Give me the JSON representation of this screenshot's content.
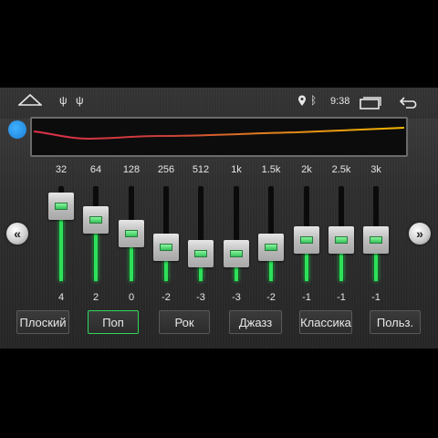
{
  "status_bar": {
    "time": "9:38",
    "icons": [
      "home-icon",
      "usb-icon",
      "usb-icon",
      "location-icon",
      "bluetooth-icon",
      "recents-icon",
      "back-icon"
    ]
  },
  "equalizer": {
    "bands": [
      {
        "freq": "32",
        "value": "4",
        "level": 4
      },
      {
        "freq": "64",
        "value": "2",
        "level": 2
      },
      {
        "freq": "128",
        "value": "0",
        "level": 0
      },
      {
        "freq": "256",
        "value": "-2",
        "level": -2
      },
      {
        "freq": "512",
        "value": "-3",
        "level": -3
      },
      {
        "freq": "1k",
        "value": "-3",
        "level": -3
      },
      {
        "freq": "1.5k",
        "value": "-2",
        "level": -2
      },
      {
        "freq": "2k",
        "value": "-1",
        "level": -1
      },
      {
        "freq": "2.5k",
        "value": "-1",
        "level": -1
      },
      {
        "freq": "3k",
        "value": "-1",
        "level": -1
      }
    ],
    "level_range": [
      -7,
      7
    ],
    "colors": {
      "fill": "#2ee05a",
      "curve_low": "#e0304a",
      "curve_high": "#f5b800",
      "indicator": "#2a9af0"
    }
  },
  "presets": [
    {
      "label": "Плоский",
      "active": false
    },
    {
      "label": "Поп",
      "active": true
    },
    {
      "label": "Рок",
      "active": false
    },
    {
      "label": "Джазз",
      "active": false
    },
    {
      "label": "Классика",
      "active": false
    },
    {
      "label": "Польз.",
      "active": false
    }
  ],
  "navigation": {
    "prev_icon": "chevron-double-left-icon",
    "next_icon": "chevron-double-right-icon"
  }
}
